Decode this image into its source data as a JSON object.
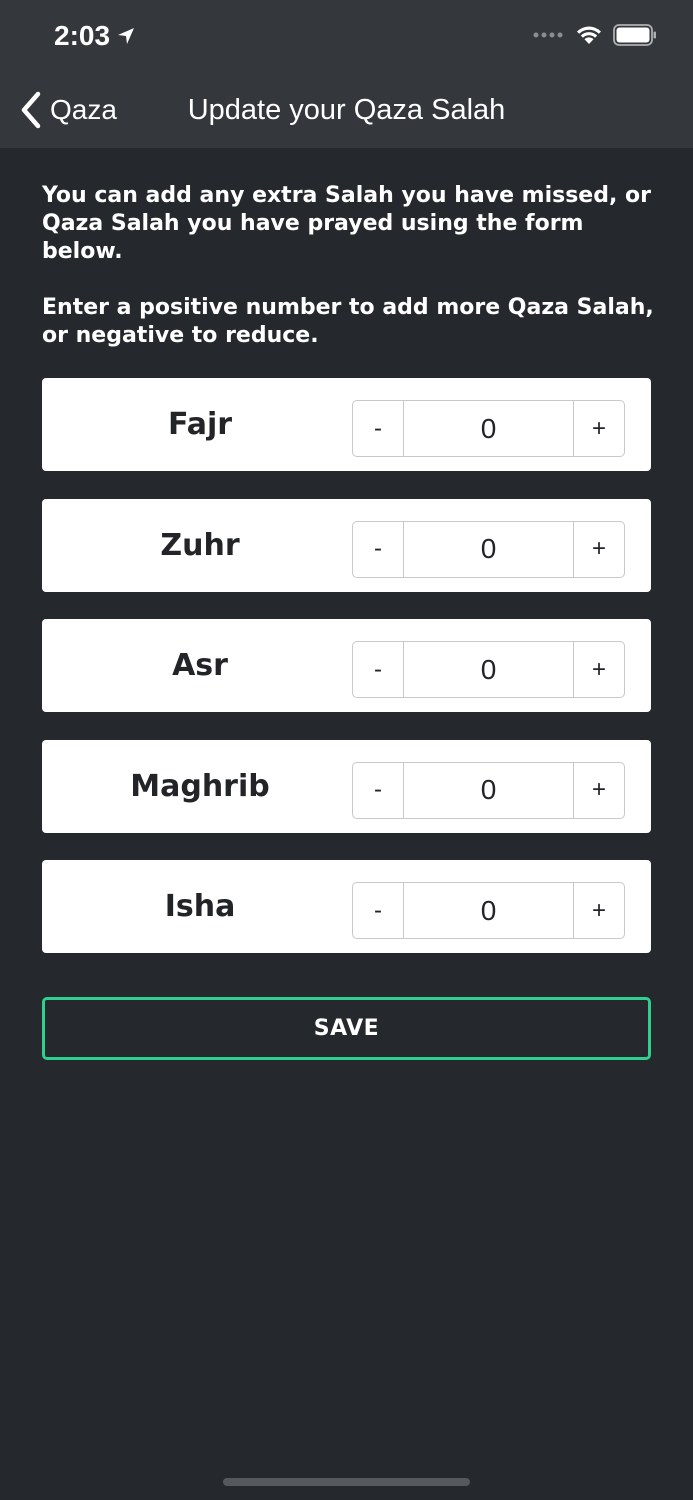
{
  "status_bar": {
    "time": "2:03",
    "icons": [
      "location-arrow-icon",
      "signal-dots-icon",
      "wifi-icon",
      "battery-icon"
    ]
  },
  "nav": {
    "back_label": "Qaza",
    "title": "Update your Qaza Salah"
  },
  "intro": {
    "paragraph1": "You can add any extra Salah you have missed, or Qaza Salah you have prayed using the form below.",
    "paragraph2": "Enter a positive number to add more Qaza Salah, or negative to reduce."
  },
  "prayers": [
    {
      "name": "Fajr",
      "value": "0",
      "minus": "-",
      "plus": "+"
    },
    {
      "name": "Zuhr",
      "value": "0",
      "minus": "-",
      "plus": "+"
    },
    {
      "name": "Asr",
      "value": "0",
      "minus": "-",
      "plus": "+"
    },
    {
      "name": "Maghrib",
      "value": "0",
      "minus": "-",
      "plus": "+"
    },
    {
      "name": "Isha",
      "value": "0",
      "minus": "-",
      "plus": "+"
    }
  ],
  "save_label": "SAVE",
  "colors": {
    "background": "#25282c",
    "header": "#34373b",
    "accent": "#2fcf8e",
    "card": "#ffffff"
  }
}
